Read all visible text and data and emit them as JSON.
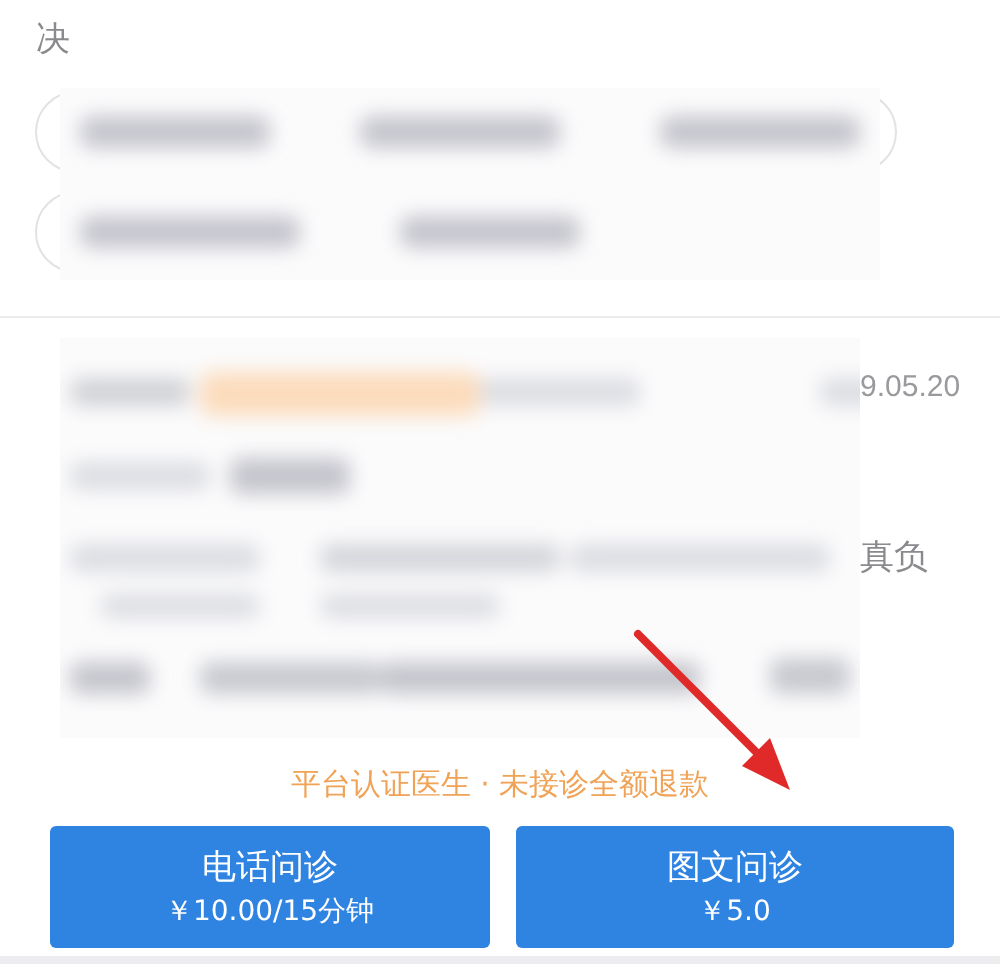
{
  "heading": "决",
  "info": {
    "date": "9.05.20",
    "note": "真负"
  },
  "guarantee": "平台认证医生 · 未接诊全额退款",
  "buttons": [
    {
      "title": "电话问诊",
      "price": "￥10.00/15分钟"
    },
    {
      "title": "图文问诊",
      "price": "￥5.0"
    }
  ]
}
